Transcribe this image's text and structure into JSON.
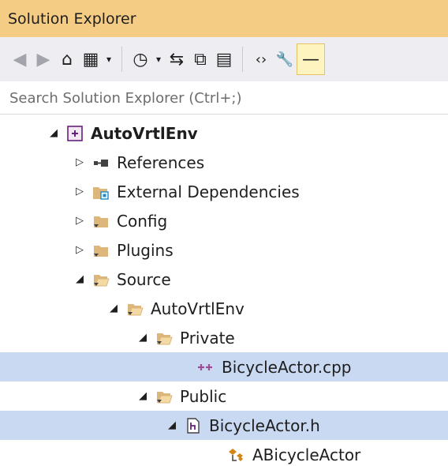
{
  "window": {
    "title": "Solution Explorer"
  },
  "toolbar": {
    "items": [
      {
        "name": "back-icon",
        "glyph": "◀"
      },
      {
        "name": "forward-icon",
        "glyph": "▶"
      },
      {
        "name": "home-icon",
        "glyph": "⌂"
      },
      {
        "name": "switch-views-icon",
        "glyph": "▦"
      },
      {
        "name": "dropdown-arrow-icon",
        "glyph": "▾"
      },
      {
        "name": "pending-changes-filter-icon",
        "glyph": "◷"
      },
      {
        "name": "dropdown-arrow-icon",
        "glyph": "▾"
      },
      {
        "name": "sync-icon",
        "glyph": "⇆"
      },
      {
        "name": "collapse-all-icon",
        "glyph": "⧉"
      },
      {
        "name": "show-all-files-icon",
        "glyph": "▤"
      },
      {
        "name": "preview-code-icon",
        "glyph": "‹›"
      },
      {
        "name": "properties-icon",
        "glyph": "🔧"
      },
      {
        "name": "pin-icon",
        "glyph": "—"
      }
    ]
  },
  "search": {
    "placeholder": "Search Solution Explorer (Ctrl+;)"
  },
  "tree": {
    "nodes": [
      {
        "label": "AutoVrtlEnv",
        "expand": "◢",
        "icon": "project-icon",
        "bold": true
      },
      {
        "label": "References",
        "expand": "▷",
        "icon": "references-icon"
      },
      {
        "label": "External Dependencies",
        "expand": "▷",
        "icon": "external-dependencies-icon"
      },
      {
        "label": "Config",
        "expand": "▷",
        "icon": "folder-icon"
      },
      {
        "label": "Plugins",
        "expand": "▷",
        "icon": "folder-icon"
      },
      {
        "label": "Source",
        "expand": "◢",
        "icon": "open-folder-icon"
      },
      {
        "label": "AutoVrtlEnv",
        "expand": "◢",
        "icon": "open-folder-icon"
      },
      {
        "label": "Private",
        "expand": "◢",
        "icon": "open-folder-icon"
      },
      {
        "label": "BicycleActor.cpp",
        "expand": "",
        "icon": "cpp-file-icon"
      },
      {
        "label": "Public",
        "expand": "◢",
        "icon": "open-folder-icon"
      },
      {
        "label": "BicycleActor.h",
        "expand": "◢",
        "icon": "header-file-icon"
      },
      {
        "label": "ABicycleActor",
        "expand": "",
        "icon": "class-icon"
      }
    ]
  },
  "colors": {
    "title_bar": "#f5cc84",
    "toolbar_bg": "#eeeef2",
    "selected_row": "#cce8ff",
    "selected_row_inactive": "#c9d9f2",
    "folder": "#dcb67a"
  }
}
